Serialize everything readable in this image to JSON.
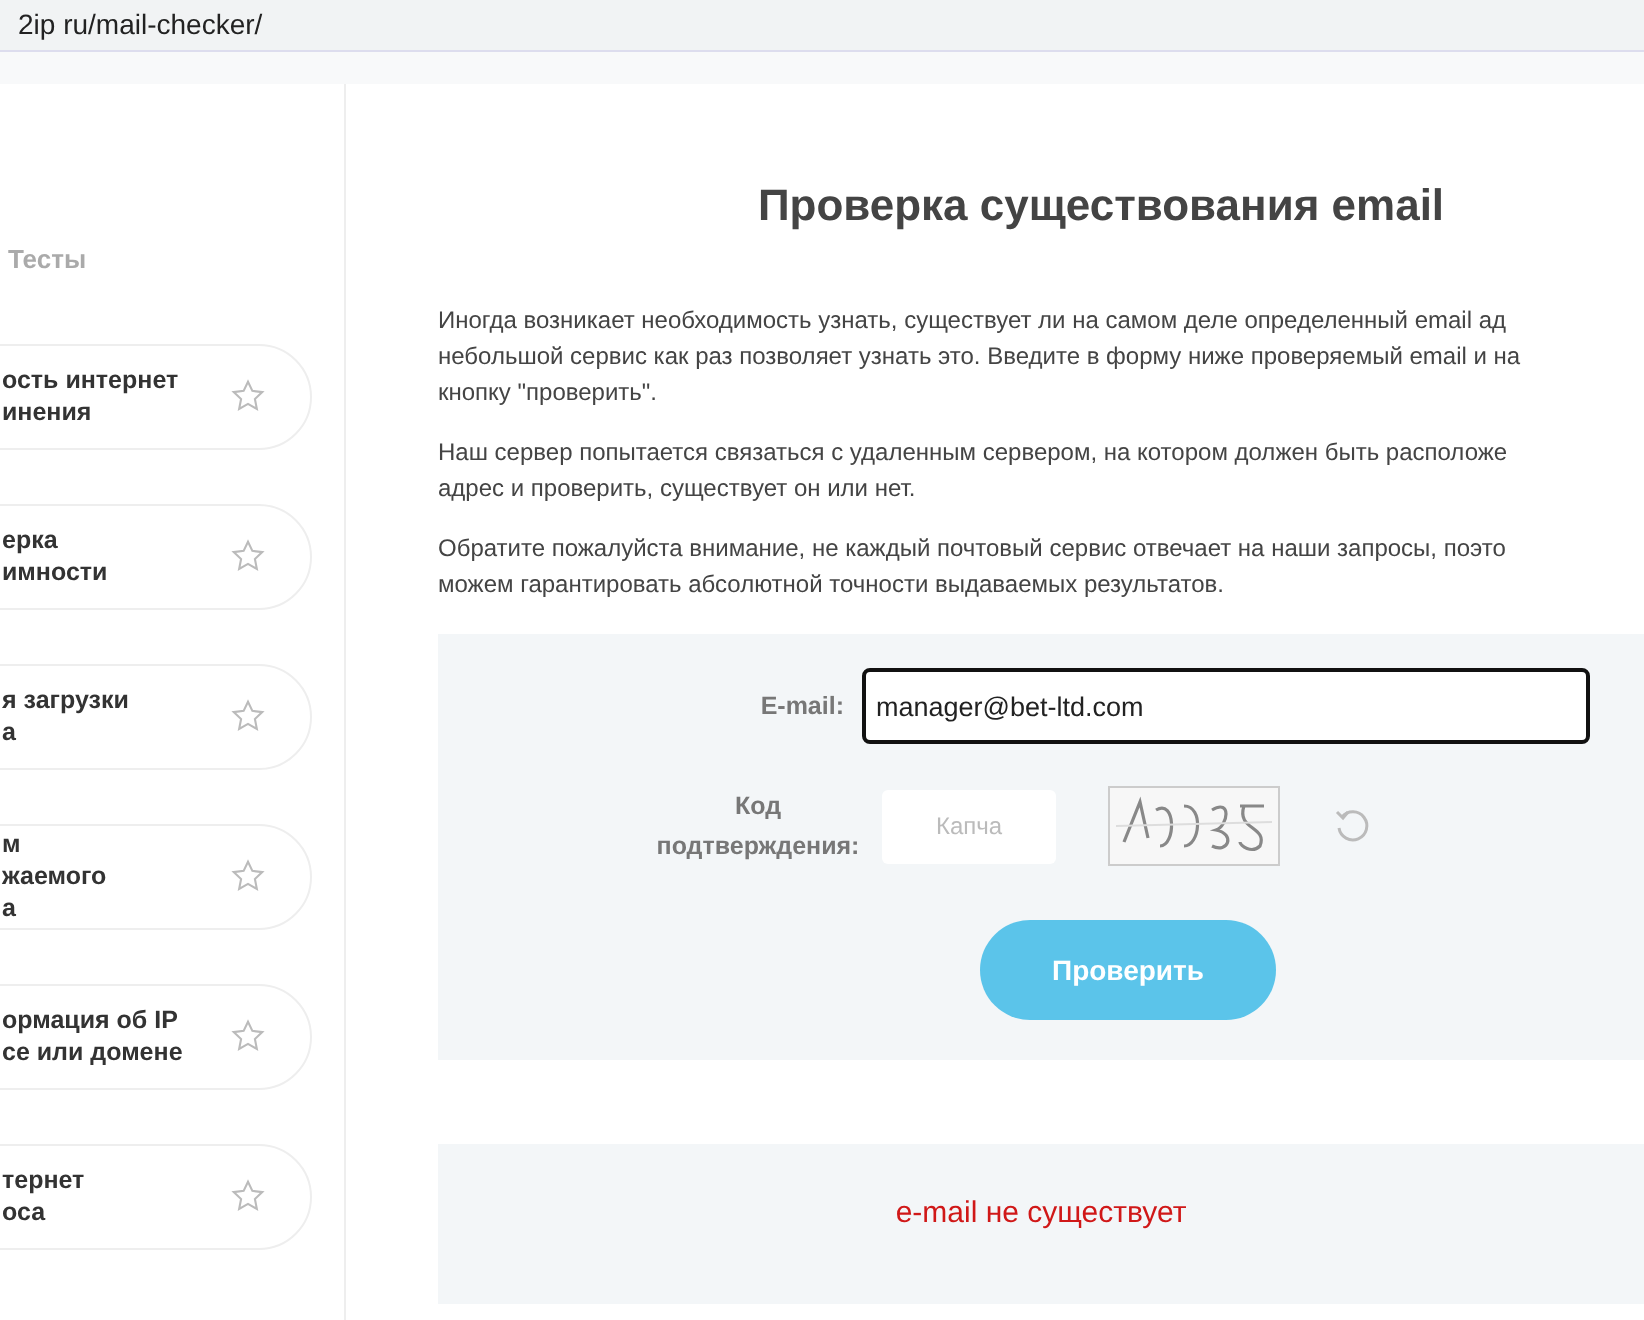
{
  "address_bar": {
    "url": "2ip ru/mail-checker/"
  },
  "sidebar": {
    "heading": "Тесты",
    "items": [
      {
        "lines": [
          "ость интернет",
          "инения"
        ],
        "favorite": false
      },
      {
        "lines": [
          "ерка",
          "имности"
        ],
        "favorite": false
      },
      {
        "lines": [
          "я загрузки",
          "а"
        ],
        "favorite": false
      },
      {
        "lines": [
          "м",
          "жаемого",
          "а"
        ],
        "favorite": false
      },
      {
        "lines": [
          "ормация об IP",
          "се или домене"
        ],
        "favorite": false
      },
      {
        "lines": [
          "тернет",
          "оса"
        ],
        "favorite": false
      }
    ]
  },
  "main": {
    "title": "Проверка существования email",
    "paragraphs": [
      [
        "Иногда возникает необходимость узнать, существует ли на самом деле определенный email ад",
        "небольшой сервис как раз позволяет узнать это. Введите в форму ниже проверяемый email и на",
        "кнопку \"проверить\"."
      ],
      [
        "Наш сервер попытается связаться с удаленным сервером, на котором должен быть расположе",
        "адрес и проверить, существует он или нет."
      ],
      [
        "Обратите пожалуйста внимание, не каждый почтовый сервис отвечает на наши запросы, поэто",
        "можем гарантировать абсолютной точности выдаваемых результатов."
      ]
    ],
    "form": {
      "email_label": "E-mail:",
      "email_value": "manager@bet-ltd.com",
      "captcha_label": "Код подтверждения:",
      "captcha_placeholder": "Капча",
      "submit": "Проверить"
    },
    "result": {
      "text": "e-mail не существует",
      "kind": "error"
    }
  }
}
